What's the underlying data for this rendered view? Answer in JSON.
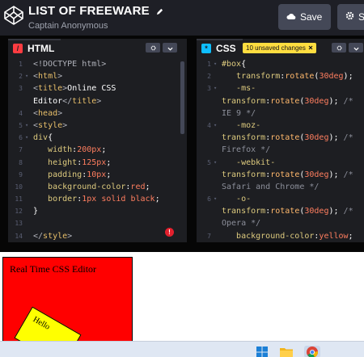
{
  "header": {
    "project_title": "LIST OF FREEWARE",
    "author": "Captain Anonymous",
    "save_label": "Save",
    "settings_label": "S"
  },
  "editors": {
    "html": {
      "tab_label": "HTML",
      "tab_icon": "/",
      "lines": [
        {
          "n": "1",
          "fold": "",
          "segments": [
            {
              "c": "tag",
              "t": "<!DOCTYPE html>"
            }
          ]
        },
        {
          "n": "2",
          "fold": "▾",
          "segments": [
            {
              "c": "tag",
              "t": "<"
            },
            {
              "c": "tagn",
              "t": "html"
            },
            {
              "c": "tag",
              "t": ">"
            }
          ]
        },
        {
          "n": "3",
          "fold": "",
          "segments": [
            {
              "c": "tag",
              "t": "<"
            },
            {
              "c": "tagn",
              "t": "title"
            },
            {
              "c": "tag",
              "t": ">"
            },
            {
              "c": "plain",
              "t": "Online CSS"
            }
          ]
        },
        {
          "n": "",
          "fold": "",
          "segments": [
            {
              "c": "plain",
              "t": "Editor"
            },
            {
              "c": "tag",
              "t": "</"
            },
            {
              "c": "tagn",
              "t": "title"
            },
            {
              "c": "tag",
              "t": ">"
            }
          ]
        },
        {
          "n": "4",
          "fold": "",
          "segments": [
            {
              "c": "tag",
              "t": "<"
            },
            {
              "c": "tagn",
              "t": "head"
            },
            {
              "c": "tag",
              "t": ">"
            }
          ]
        },
        {
          "n": "5",
          "fold": "▾",
          "segments": [
            {
              "c": "tag",
              "t": "<"
            },
            {
              "c": "tagn",
              "t": "style"
            },
            {
              "c": "tag",
              "t": ">"
            }
          ]
        },
        {
          "n": "6",
          "fold": "▾",
          "segments": [
            {
              "c": "sel",
              "t": "div"
            },
            {
              "c": "plain",
              "t": "{"
            }
          ]
        },
        {
          "n": "7",
          "fold": "",
          "segments": [
            {
              "c": "prop",
              "t": "   width"
            },
            {
              "c": "plain",
              "t": ":"
            },
            {
              "c": "num",
              "t": "200px"
            },
            {
              "c": "plain",
              "t": ";"
            }
          ]
        },
        {
          "n": "8",
          "fold": "",
          "segments": [
            {
              "c": "prop",
              "t": "   height"
            },
            {
              "c": "plain",
              "t": ":"
            },
            {
              "c": "num",
              "t": "125px"
            },
            {
              "c": "plain",
              "t": ";"
            }
          ]
        },
        {
          "n": "9",
          "fold": "",
          "segments": [
            {
              "c": "prop",
              "t": "   padding"
            },
            {
              "c": "plain",
              "t": ":"
            },
            {
              "c": "num",
              "t": "10px"
            },
            {
              "c": "plain",
              "t": ";"
            }
          ]
        },
        {
          "n": "10",
          "fold": "",
          "segments": [
            {
              "c": "prop",
              "t": "   background-color"
            },
            {
              "c": "plain",
              "t": ":"
            },
            {
              "c": "val",
              "t": "red"
            },
            {
              "c": "plain",
              "t": ";"
            }
          ]
        },
        {
          "n": "11",
          "fold": "",
          "segments": [
            {
              "c": "prop",
              "t": "   border"
            },
            {
              "c": "plain",
              "t": ":"
            },
            {
              "c": "num",
              "t": "1px"
            },
            {
              "c": "plain",
              "t": " "
            },
            {
              "c": "val",
              "t": "solid"
            },
            {
              "c": "plain",
              "t": " "
            },
            {
              "c": "val",
              "t": "black"
            },
            {
              "c": "plain",
              "t": ";"
            }
          ]
        },
        {
          "n": "12",
          "fold": "",
          "segments": [
            {
              "c": "plain",
              "t": "}"
            }
          ]
        },
        {
          "n": "13",
          "fold": "",
          "segments": []
        },
        {
          "n": "14",
          "fold": "",
          "segments": [
            {
              "c": "tag",
              "t": "</"
            },
            {
              "c": "tagn",
              "t": "style"
            },
            {
              "c": "tag",
              "t": ">"
            }
          ]
        }
      ]
    },
    "css": {
      "tab_label": "CSS",
      "tab_icon": "*",
      "unsaved_badge": "10 unsaved changes",
      "lines": [
        {
          "n": "1",
          "fold": "▾",
          "segments": [
            {
              "c": "sel",
              "t": "#box"
            },
            {
              "c": "plain",
              "t": "{"
            }
          ]
        },
        {
          "n": "2",
          "fold": "",
          "segments": [
            {
              "c": "prop",
              "t": "   transform"
            },
            {
              "c": "plain",
              "t": ":"
            },
            {
              "c": "fn",
              "t": "rotate"
            },
            {
              "c": "plain",
              "t": "("
            },
            {
              "c": "num",
              "t": "30deg"
            },
            {
              "c": "plain",
              "t": ");"
            }
          ]
        },
        {
          "n": "3",
          "fold": "▾",
          "segments": [
            {
              "c": "prop",
              "t": "   -ms-"
            }
          ]
        },
        {
          "n": "",
          "fold": "",
          "segments": [
            {
              "c": "prop",
              "t": "transform"
            },
            {
              "c": "plain",
              "t": ":"
            },
            {
              "c": "fn",
              "t": "rotate"
            },
            {
              "c": "plain",
              "t": "("
            },
            {
              "c": "num",
              "t": "30deg"
            },
            {
              "c": "plain",
              "t": "); "
            },
            {
              "c": "comment-gray",
              "t": "/*"
            }
          ]
        },
        {
          "n": "",
          "fold": "",
          "segments": [
            {
              "c": "comment-gray",
              "t": "IE 9 */"
            }
          ]
        },
        {
          "n": "4",
          "fold": "▾",
          "segments": [
            {
              "c": "prop",
              "t": "   -moz-"
            }
          ]
        },
        {
          "n": "",
          "fold": "",
          "segments": [
            {
              "c": "prop",
              "t": "transform"
            },
            {
              "c": "plain",
              "t": ":"
            },
            {
              "c": "fn",
              "t": "rotate"
            },
            {
              "c": "plain",
              "t": "("
            },
            {
              "c": "num",
              "t": "30deg"
            },
            {
              "c": "plain",
              "t": "); "
            },
            {
              "c": "comment-gray",
              "t": "/*"
            }
          ]
        },
        {
          "n": "",
          "fold": "",
          "segments": [
            {
              "c": "comment-gray",
              "t": "Firefox */"
            }
          ]
        },
        {
          "n": "5",
          "fold": "▾",
          "segments": [
            {
              "c": "prop",
              "t": "   -webkit-"
            }
          ]
        },
        {
          "n": "",
          "fold": "",
          "segments": [
            {
              "c": "prop",
              "t": "transform"
            },
            {
              "c": "plain",
              "t": ":"
            },
            {
              "c": "fn",
              "t": "rotate"
            },
            {
              "c": "plain",
              "t": "("
            },
            {
              "c": "num",
              "t": "30deg"
            },
            {
              "c": "plain",
              "t": "); "
            },
            {
              "c": "comment-gray",
              "t": "/*"
            }
          ]
        },
        {
          "n": "",
          "fold": "",
          "segments": [
            {
              "c": "comment-gray",
              "t": "Safari and Chrome */"
            }
          ]
        },
        {
          "n": "6",
          "fold": "▾",
          "segments": [
            {
              "c": "prop",
              "t": "   -o-"
            }
          ]
        },
        {
          "n": "",
          "fold": "",
          "segments": [
            {
              "c": "prop",
              "t": "transform"
            },
            {
              "c": "plain",
              "t": ":"
            },
            {
              "c": "fn",
              "t": "rotate"
            },
            {
              "c": "plain",
              "t": "("
            },
            {
              "c": "num",
              "t": "30deg"
            },
            {
              "c": "plain",
              "t": "); "
            },
            {
              "c": "comment-gray",
              "t": "/*"
            }
          ]
        },
        {
          "n": "",
          "fold": "",
          "segments": [
            {
              "c": "comment-gray",
              "t": "Opera */"
            }
          ]
        },
        {
          "n": "7",
          "fold": "",
          "segments": [
            {
              "c": "prop",
              "t": "   background-color"
            },
            {
              "c": "plain",
              "t": ":"
            },
            {
              "c": "val",
              "t": "yellow"
            },
            {
              "c": "plain",
              "t": ";"
            }
          ]
        }
      ]
    }
  },
  "preview": {
    "box_text": "Real Time CSS Editor",
    "rotated_text": "Hello"
  },
  "taskbar": {
    "icons": [
      "windows-start-icon",
      "file-explorer-icon",
      "chrome-icon"
    ]
  },
  "colors": {
    "header_bg": "#1e1f26",
    "editor_bg": "#1d1e22",
    "html_accent": "#ff3c41",
    "css_accent": "#0ebeff",
    "unsaved_badge": "#ffdd40",
    "preview_box": "#ff0000",
    "rotated_box": "#ffff00"
  }
}
